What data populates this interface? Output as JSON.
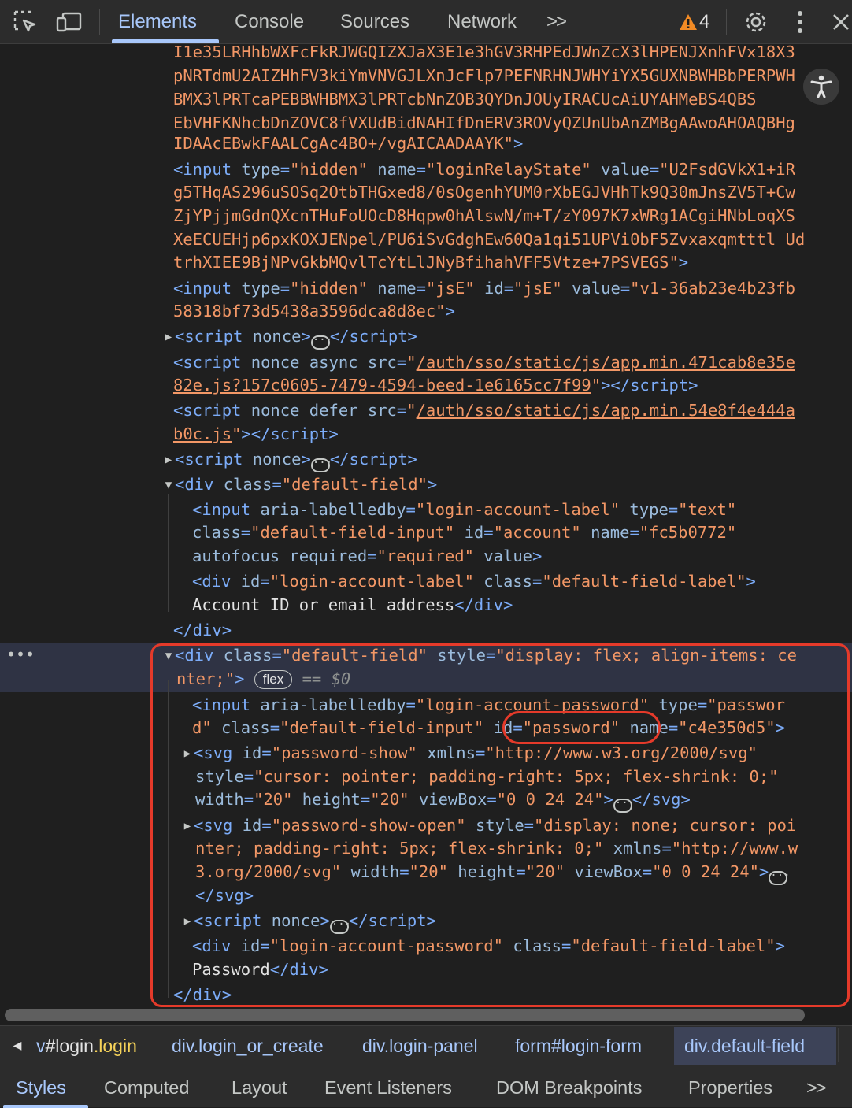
{
  "toolbar": {
    "tabs": [
      "Elements",
      "Console",
      "Sources",
      "Network"
    ],
    "more_tabs": ">>",
    "warning_count": "4",
    "icons": [
      "inspect-icon",
      "device-toggle-icon",
      "warning-icon",
      "settings-gear-icon",
      "kebab-menu-icon",
      "close-icon"
    ]
  },
  "dom": {
    "l1": "I1e35LRHhbWXFcFkRJWGQIZXJaX3E1e3hGV3RHPEdJWnZcX3lHPENJXnhFVx18X3",
    "l2": "pNRTdmU2AIZHhFV3kiYmVNVGJLXnJcFlp7PEFNRHNJWHYiYX5GUXNBWHBbPERPWH",
    "l3": "BMX3lPRTcaPEBBWHBMX3lPRTcbNnZOB3QYDnJOUyIRACUcAiUYAHMeBS4QBS",
    "l4": "EbVHFKNhcbDnZOVC8fVXUdBidNAHIfDnERV3ROVyQZUnUbAnZMBgAAwoAHOAQBHg",
    "l5": "IDAAcEBwkFAALCgAc4BO+/vgAICAADAAYK",
    "input1_tag": "input",
    "input1_type": "hidden",
    "input1_name": "loginRelayState",
    "input1_v1": "U2FsdGVkX1+iR",
    "input1_v2": "g5THqAS296uSOSq2OtbTHGxed8/0sOgenhYUM0rXbEGJVHhTk9Q30mJnsZV5T+Cw",
    "input1_v3": "ZjYPjjmGdnQXcnTHuFoUOcD8Hqpw0hAlswN/m+T/zY097K7xWRg1ACgiHNbLoqXS",
    "input1_v4": "XeECUEHjp6pxKOXJENpel/PU6iSvGdghEw60Qa1qi51UPVi0bF5Zvxaxqmtttl Ud",
    "input1_v5": "trhXIEE9BjNPvGkbMQvlTcYtLlJNyBfihahVFF5Vtze+7PSVEGS",
    "input2_name": "jsE",
    "input2_id": "jsE",
    "input2_v1": "v1-36ab23e4b23fb",
    "input2_v2": "58318bf73d5438a3596dca8d8ec",
    "script1_src1": "/auth/sso/static/js/app.min.471cab8e35e",
    "script1_src2": "82e.js?157c0605-7479-4594-beed-1e6165cc7f99",
    "script2_src1": "/auth/sso/static/js/app.min.54e8f4e444a",
    "script2_src2": "b0c.js",
    "field1_class": "default-field",
    "acc_labelledby": "login-account-label",
    "acc_type": "text",
    "acc_class": "default-field-input",
    "acc_id": "account",
    "acc_name": "fc5b0772",
    "acc_required": "required",
    "acc_label_id": "login-account-label",
    "acc_label_class": "default-field-label",
    "acc_label_text": "Account ID or email address",
    "field2_style1": "display: flex; align-items: ce",
    "field2_style2": "nter;",
    "flex_badge": "flex",
    "eq0": "== $0",
    "pw_labelledby": "login-account-password",
    "pw_type1": "passwor",
    "pw_type2": "d",
    "pw_class": "default-field-input",
    "pw_id": "password",
    "pw_name": "c4e350d5",
    "svg1_id": "password-show",
    "xmlns": "http://www.w3.org/2000/svg",
    "svg1_style": "cursor: pointer; padding-right: 5px; flex-shrink: 0;",
    "w20": "20",
    "vb": "0 0 24 24",
    "svg2_id": "password-show-open",
    "svg2_style1": "display: none; cursor: poi",
    "svg2_style2": "nter; padding-right: 5px; flex-shrink: 0;",
    "xmlns_a": "http://www.w",
    "xmlns_b": "3.org/2000/svg",
    "pw_label_id": "login-account-password",
    "pw_label_class": "default-field-label",
    "pw_label_text": "Password"
  },
  "breadcrumbs": {
    "c1_a": "v",
    "c1_b": "#login",
    "c1_c": ".login",
    "c2": "div.login_or_create",
    "c3": "div.login-panel",
    "c4": "form#login-form",
    "c5": "div.default-field"
  },
  "bottom_tabs": [
    "Styles",
    "Computed",
    "Layout",
    "Event Listeners",
    "DOM Breakpoints",
    "Properties"
  ],
  "bottom_more": ">>"
}
